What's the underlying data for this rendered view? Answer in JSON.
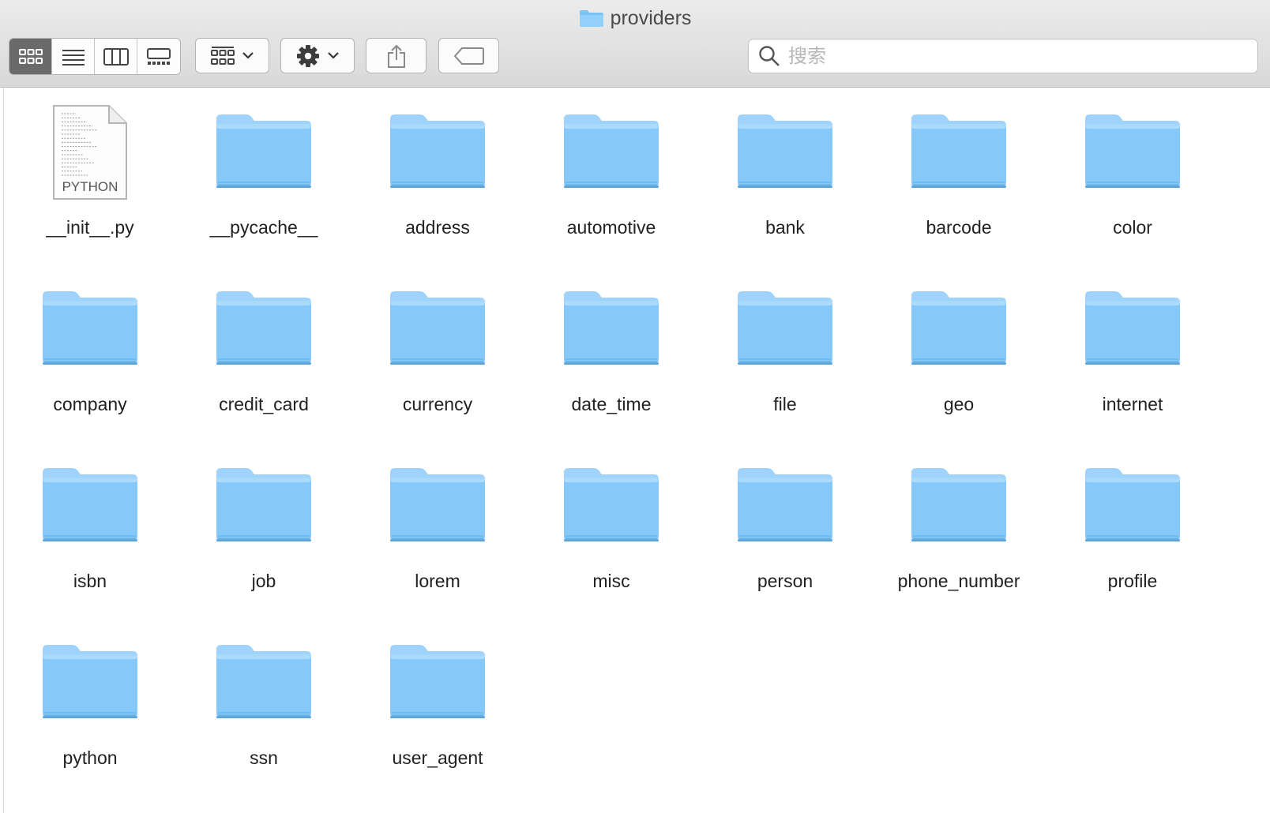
{
  "window": {
    "title": "providers"
  },
  "toolbar": {
    "view_modes": [
      "icon-view",
      "list-view",
      "column-view",
      "gallery-view"
    ],
    "active_view": "icon-view",
    "group_button_icon": "group-grid-icon",
    "action_button_icon": "gear-icon",
    "share_button_icon": "share-icon",
    "tag_button_icon": "tag-icon"
  },
  "search": {
    "placeholder": "搜索",
    "value": ""
  },
  "file_icon_label": "PYTHON",
  "items": [
    {
      "name": "__init__.py",
      "kind": "file"
    },
    {
      "name": "__pycache__",
      "kind": "folder"
    },
    {
      "name": "address",
      "kind": "folder"
    },
    {
      "name": "automotive",
      "kind": "folder"
    },
    {
      "name": "bank",
      "kind": "folder"
    },
    {
      "name": "barcode",
      "kind": "folder"
    },
    {
      "name": "color",
      "kind": "folder"
    },
    {
      "name": "company",
      "kind": "folder"
    },
    {
      "name": "credit_card",
      "kind": "folder"
    },
    {
      "name": "currency",
      "kind": "folder"
    },
    {
      "name": "date_time",
      "kind": "folder"
    },
    {
      "name": "file",
      "kind": "folder"
    },
    {
      "name": "geo",
      "kind": "folder"
    },
    {
      "name": "internet",
      "kind": "folder"
    },
    {
      "name": "isbn",
      "kind": "folder"
    },
    {
      "name": "job",
      "kind": "folder"
    },
    {
      "name": "lorem",
      "kind": "folder"
    },
    {
      "name": "misc",
      "kind": "folder"
    },
    {
      "name": "person",
      "kind": "folder"
    },
    {
      "name": "phone_number",
      "kind": "folder"
    },
    {
      "name": "profile",
      "kind": "folder"
    },
    {
      "name": "python",
      "kind": "folder"
    },
    {
      "name": "ssn",
      "kind": "folder"
    },
    {
      "name": "user_agent",
      "kind": "folder"
    }
  ],
  "colors": {
    "folder_top": "#9fd3fb",
    "folder_body": "#86c8f7",
    "folder_edge": "#69b2ea",
    "active_segment": "#6a6a6a"
  }
}
